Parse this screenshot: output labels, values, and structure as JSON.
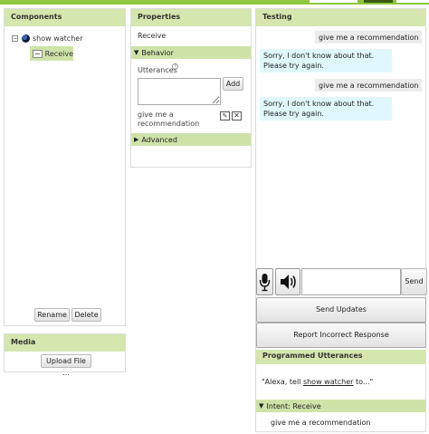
{
  "components": {
    "title": "Components",
    "tree_root_label": "show watcher",
    "tree_child_label": "Receive",
    "rename_label": "Rename",
    "delete_label": "Delete"
  },
  "media": {
    "title": "Media",
    "upload_label": "Upload File ..."
  },
  "properties": {
    "title": "Properties",
    "selected_component": "Receive",
    "behavior_label": "Behavior",
    "utterances_label": "Utterances",
    "utterances_help": "?",
    "add_label": "Add",
    "utterance_item": "give me a recommendation",
    "advanced_label": "Advanced",
    "expanded_arrow": "▼",
    "collapsed_arrow": "▶"
  },
  "testing": {
    "title": "Testing",
    "messages": [
      {
        "from": "user",
        "text": "give me a recommendation"
      },
      {
        "from": "bot",
        "text": "Sorry, I don't know about that. Please try again."
      },
      {
        "from": "user",
        "text": "give me a recommendation"
      },
      {
        "from": "bot",
        "text": "Sorry, I don't know about that. Please try again."
      }
    ],
    "send_label": "Send",
    "send_updates_label": "Send Updates",
    "report_label": "Report Incorrect Response",
    "programmed_title": "Programmed Utterances",
    "quote_prefix": "\"Alexa, tell ",
    "quote_link": "show watcher",
    "quote_suffix": " to...\"",
    "intent_label": "Intent: Receive",
    "intent_utterance": "give me a recommendation"
  },
  "icons": {
    "collapse": "minus-box-icon",
    "skill": "globe-icon",
    "component": "component-icon",
    "help": "help-icon",
    "edit": "edit-icon",
    "delete": "close-box-icon",
    "mic": "microphone-icon",
    "speaker": "speaker-icon"
  },
  "colors": {
    "accent_green": "#8dc63f",
    "header_green": "#d5e6ae",
    "selection_green": "#cfe3a9",
    "bot_bubble": "#e0f8fd",
    "user_bubble": "#ececec"
  }
}
